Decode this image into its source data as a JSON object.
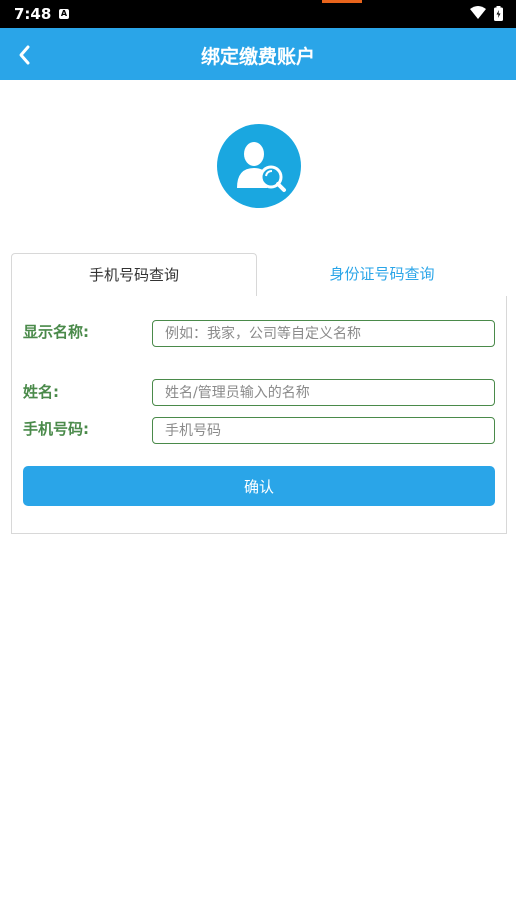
{
  "status_bar": {
    "time": "7:48",
    "notification_icon": "A"
  },
  "header": {
    "title": "绑定缴费账户",
    "back_icon": "chevron-left"
  },
  "avatar": {
    "icon": "user-search-icon",
    "color": "#1aa7e0"
  },
  "tabs": [
    {
      "label": "手机号码查询",
      "active": true
    },
    {
      "label": "身份证号码查询",
      "active": false
    }
  ],
  "form": {
    "display_name": {
      "label": "显示名称:",
      "placeholder": "例如：我家，公司等自定义名称"
    },
    "name": {
      "label": "姓名:",
      "placeholder": "姓名/管理员输入的名称"
    },
    "phone": {
      "label": "手机号码:",
      "placeholder": "手机号码"
    },
    "submit_label": "确认"
  },
  "colors": {
    "accent": "#2aa5e8",
    "label_green": "#4a8a4a"
  }
}
